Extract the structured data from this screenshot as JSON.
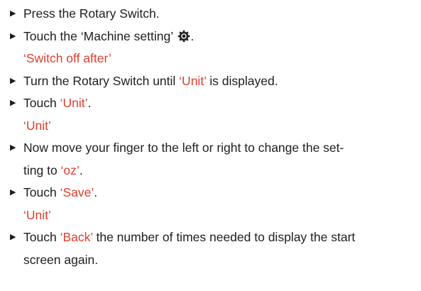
{
  "steps": [
    {
      "type": "step",
      "text_before": "Press the Rotary Switch."
    },
    {
      "type": "step",
      "text_before": "Touch the ‘Machine setting’",
      "icon": "gear-icon",
      "text_after": "."
    },
    {
      "type": "result",
      "red": "‘Switch off after’"
    },
    {
      "type": "step",
      "text_before": "Turn the Rotary Switch until ",
      "red": "‘Unit’",
      "text_after": " is displayed."
    },
    {
      "type": "step",
      "text_before": "Touch ",
      "red": "‘Unit’",
      "text_after": "."
    },
    {
      "type": "result",
      "red": "‘Unit’"
    },
    {
      "type": "step",
      "text_before": "Now move your finger to the left or right to change the set-"
    },
    {
      "type": "continuation",
      "text_before": "ting to ",
      "red": "‘oz’",
      "text_after": "."
    },
    {
      "type": "step",
      "text_before": "Touch ",
      "red": "‘Save’",
      "text_after": "."
    },
    {
      "type": "result",
      "red": "‘Unit’"
    },
    {
      "type": "step",
      "text_before": "Touch ",
      "red": "‘Back’",
      "text_after": " the number of times needed to display the start"
    },
    {
      "type": "continuation",
      "text_before": "screen again."
    }
  ],
  "bullet_glyph": "▶",
  "colors": {
    "text": "#1e1e1e",
    "highlight": "#e03e2e"
  }
}
